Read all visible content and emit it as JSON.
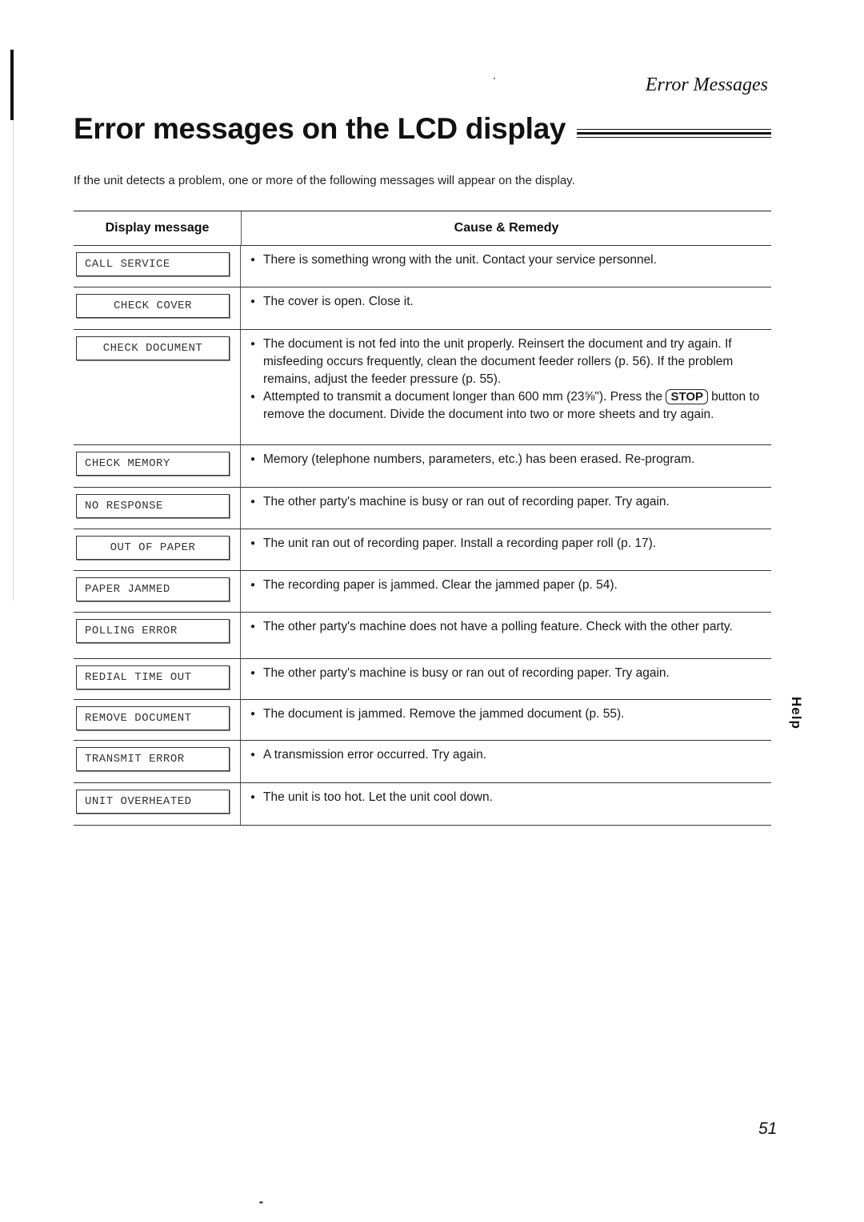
{
  "header": {
    "section_title": "Error Messages",
    "page_title": "Error messages on the LCD display",
    "intro": "If the unit detects a problem, one or more of the following messages will appear on the display."
  },
  "table": {
    "columns": [
      "Display message",
      "Cause & Remedy"
    ],
    "rows": [
      {
        "message": "CALL SERVICE",
        "causes": [
          "There is something wrong with the unit. Contact your service personnel."
        ]
      },
      {
        "message": "CHECK COVER",
        "causes": [
          "The cover is open. Close it."
        ]
      },
      {
        "message": "CHECK DOCUMENT",
        "causes": [
          "The document is not fed into the unit properly. Reinsert the document and try again. If misfeeding occurs frequently, clean the document feeder rollers (p. 56). If the problem remains, adjust the feeder pressure (p. 55).",
          "Attempted to transmit a document longer than 600 mm (23⅝\"). Press the"
        ],
        "stop_key": "STOP",
        "stop_tail": "button to remove the document. Divide the document into two or more sheets and try again."
      },
      {
        "message": "CHECK MEMORY",
        "causes": [
          "Memory (telephone numbers, parameters, etc.) has been erased. Re-program."
        ]
      },
      {
        "message": "NO RESPONSE",
        "causes": [
          "The other party's machine is busy or ran out of recording paper. Try again."
        ]
      },
      {
        "message": "OUT OF PAPER",
        "causes": [
          "The unit ran out of recording paper. Install a recording paper roll (p. 17)."
        ]
      },
      {
        "message": "PAPER JAMMED",
        "causes": [
          "The recording paper is jammed. Clear the jammed paper (p. 54)."
        ]
      },
      {
        "message": "POLLING ERROR",
        "causes": [
          "The other party's machine does not have a polling feature. Check with the other party."
        ]
      },
      {
        "message": "REDIAL TIME OUT",
        "causes": [
          "The other party's machine is busy or ran out of recording paper. Try again."
        ]
      },
      {
        "message": "REMOVE DOCUMENT",
        "causes": [
          "The document is jammed. Remove the jammed document (p. 55)."
        ]
      },
      {
        "message": "TRANSMIT ERROR",
        "causes": [
          "A transmission error occurred. Try again."
        ]
      },
      {
        "message": "UNIT OVERHEATED",
        "causes": [
          "The unit is too hot. Let the unit cool down."
        ]
      }
    ]
  },
  "side_tab": "Help",
  "page_number": "51",
  "icons": {
    "bullet": "bullet-dot-icon"
  }
}
